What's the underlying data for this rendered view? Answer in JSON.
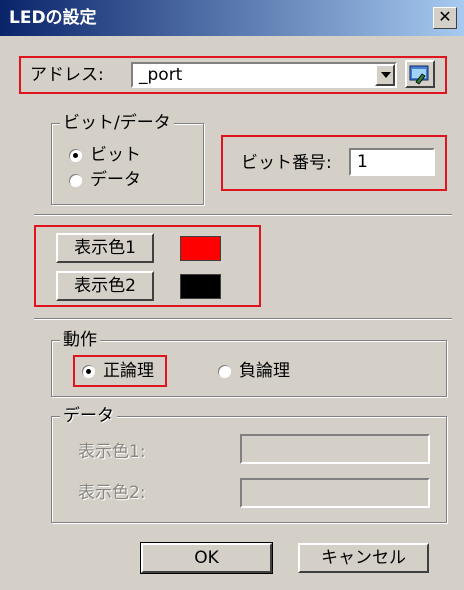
{
  "window": {
    "title": "LEDの設定",
    "close_glyph": "✕"
  },
  "address": {
    "label": "アドレス:",
    "value": "_port"
  },
  "bit_data_group": {
    "legend": "ビット/データ",
    "options": [
      {
        "label": "ビット",
        "checked": true
      },
      {
        "label": "データ",
        "checked": false
      }
    ]
  },
  "bit_number": {
    "label": "ビット番号:",
    "value": "1"
  },
  "display_colors": [
    {
      "label": "表示色1",
      "color": "#ff0000"
    },
    {
      "label": "表示色2",
      "color": "#000000"
    }
  ],
  "action_group": {
    "legend": "動作",
    "options": [
      {
        "label": "正論理",
        "checked": true
      },
      {
        "label": "負論理",
        "checked": false
      }
    ]
  },
  "data_group": {
    "legend": "データ",
    "fields": [
      {
        "label": "表示色1:",
        "value": ""
      },
      {
        "label": "表示色2:",
        "value": ""
      }
    ]
  },
  "buttons": {
    "ok": "OK",
    "cancel": "キャンセル"
  },
  "colors": {
    "titlebar_start": "#0a246a",
    "titlebar_end": "#a6caf0",
    "highlight_red": "#e0141e",
    "dialog_face": "#d4d0c8"
  }
}
